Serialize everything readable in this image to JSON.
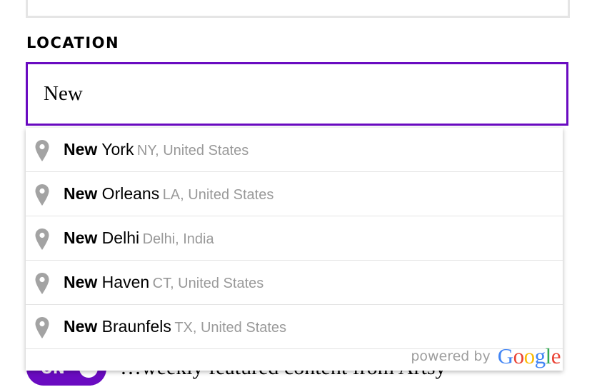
{
  "location": {
    "label": "LOCATION",
    "value": "New",
    "accent_color": "#6a0bc1"
  },
  "suggestions": [
    {
      "match": "New",
      "rest": " York",
      "secondary": "NY, United States",
      "icon": "map-pin-icon"
    },
    {
      "match": "New",
      "rest": " Orleans",
      "secondary": "LA, United States",
      "icon": "map-pin-icon"
    },
    {
      "match": "New",
      "rest": " Delhi",
      "secondary": "Delhi, India",
      "icon": "map-pin-icon"
    },
    {
      "match": "New",
      "rest": " Haven",
      "secondary": "CT, United States",
      "icon": "map-pin-icon"
    },
    {
      "match": "New",
      "rest": " Braunfels",
      "secondary": "TX, United States",
      "icon": "map-pin-icon"
    }
  ],
  "attribution": {
    "powered_by": "powered by",
    "google": [
      "G",
      "o",
      "o",
      "g",
      "l",
      "e"
    ],
    "google_colors": [
      "#4285f4",
      "#ea4335",
      "#fbbc05",
      "#4285f4",
      "#34a853",
      "#ea4335"
    ]
  },
  "newsletter": {
    "toggle_label": "ON",
    "text": "…weekly featured content from Artsy"
  }
}
